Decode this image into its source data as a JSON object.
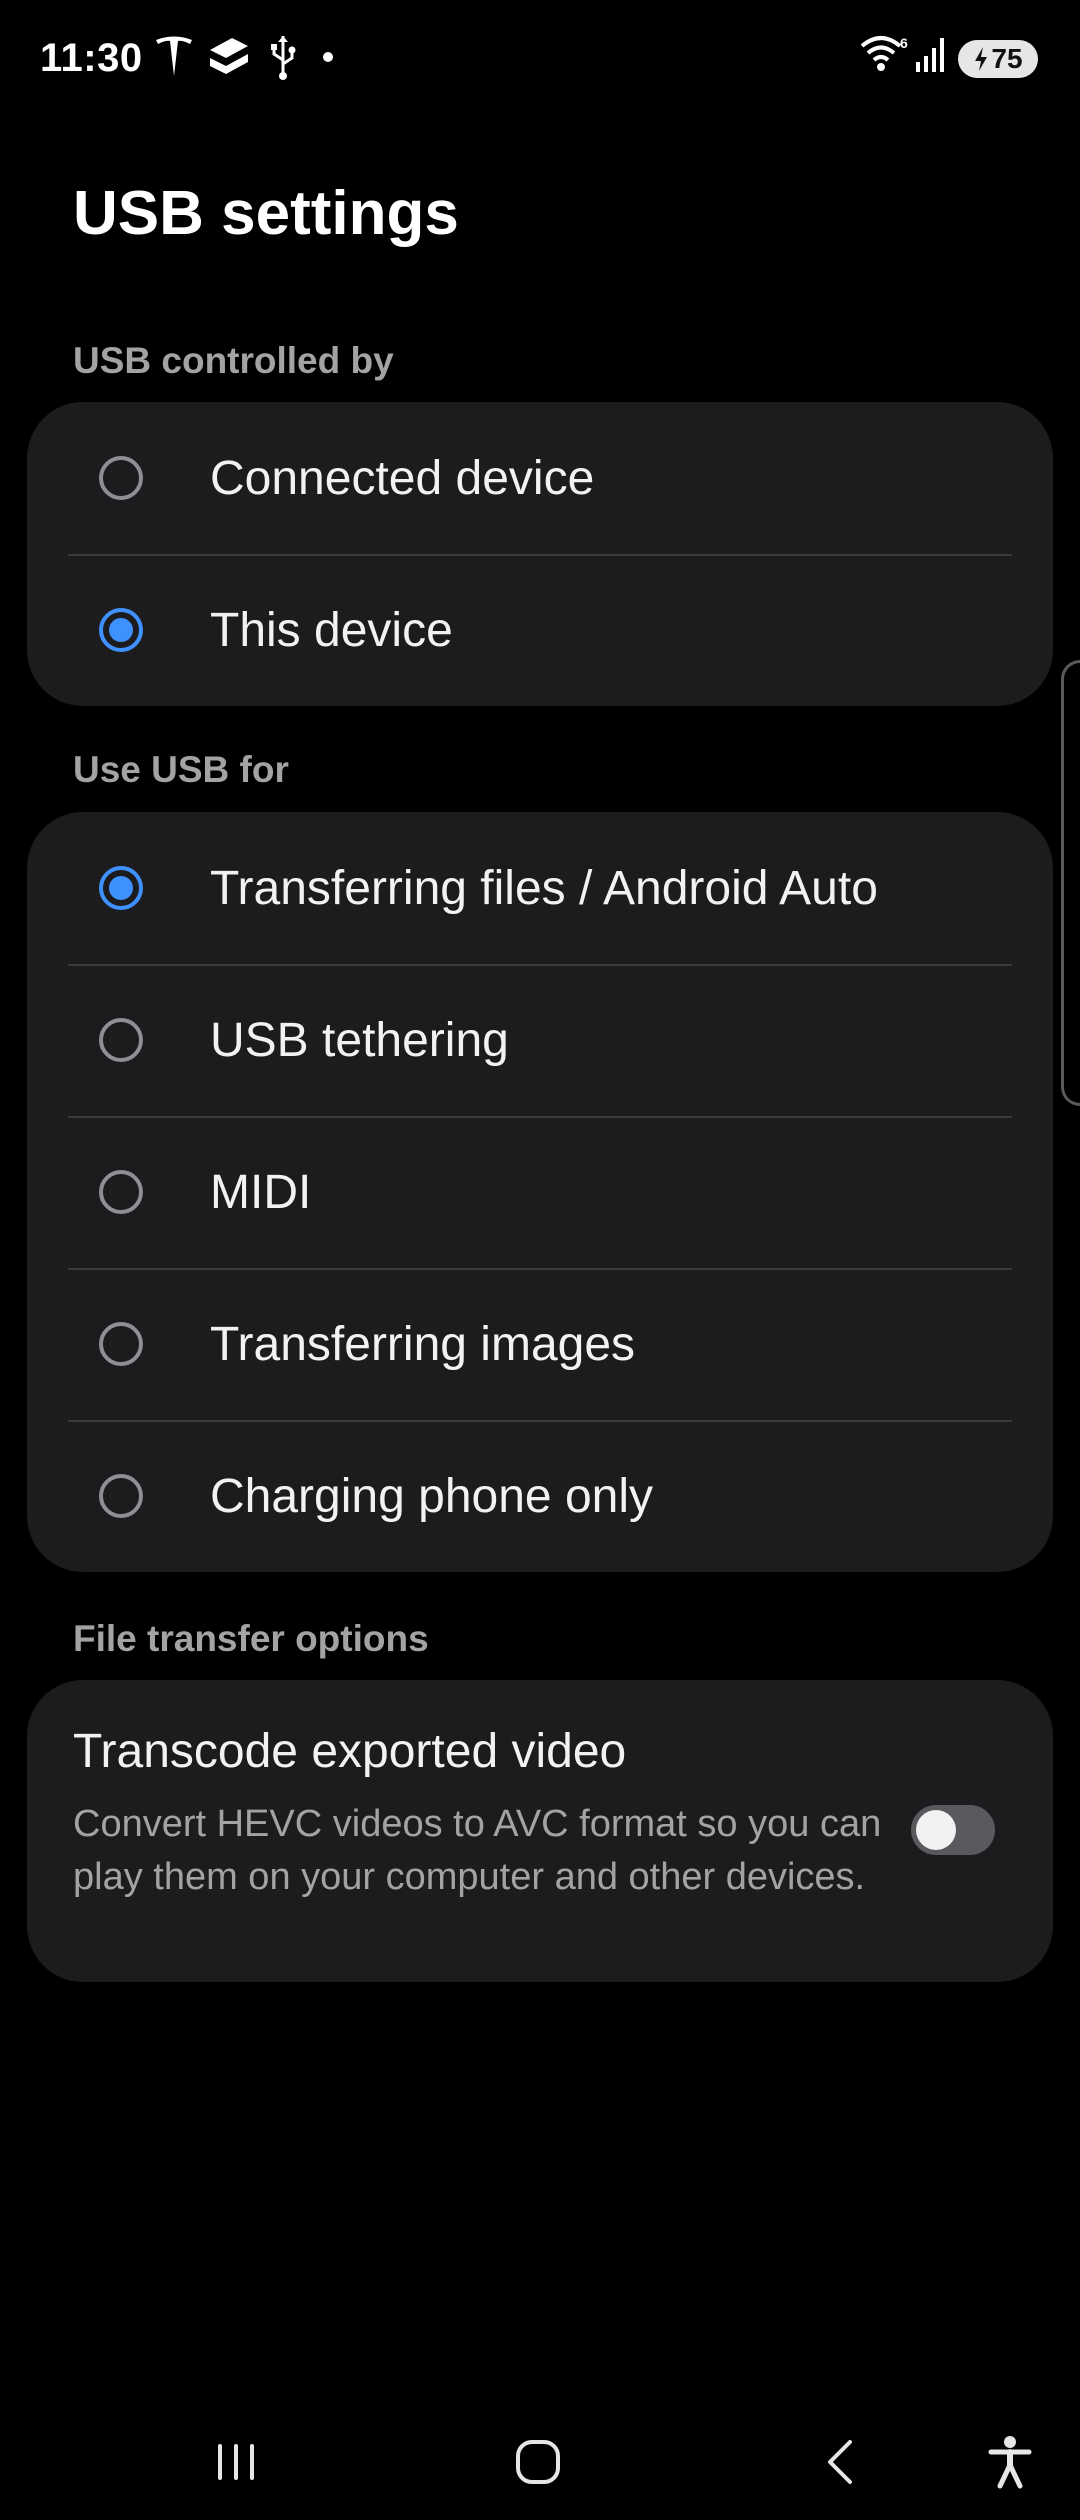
{
  "status_bar": {
    "time": "11:30",
    "battery_level": "75",
    "signal_badge": "6",
    "icons": [
      "tesla-icon",
      "sheets-icon",
      "usb-icon",
      "dot-icon",
      "wifi-icon",
      "signal-icon",
      "battery-charging-icon"
    ]
  },
  "page": {
    "title": "USB settings"
  },
  "usb_controlled_by": {
    "label": "USB controlled by",
    "options": [
      {
        "label": "Connected device",
        "checked": false
      },
      {
        "label": "This device",
        "checked": true
      }
    ]
  },
  "use_usb_for": {
    "label": "Use USB for",
    "options": [
      {
        "label": "Transferring files / Android Auto",
        "checked": true
      },
      {
        "label": "USB tethering",
        "checked": false
      },
      {
        "label": "MIDI",
        "checked": false
      },
      {
        "label": "Transferring images",
        "checked": false
      },
      {
        "label": "Charging phone only",
        "checked": false
      }
    ]
  },
  "file_transfer": {
    "label": "File transfer options",
    "title": "Transcode exported video",
    "description": "Convert HEVC videos to AVC format so you can play them on your computer and other devices.",
    "toggle_on": false
  },
  "nav_bar": {
    "icons": [
      "recents-icon",
      "home-icon",
      "back-icon",
      "accessibility-icon"
    ]
  },
  "colors": {
    "accent": "#3e91ff",
    "card": "#1c1c1e",
    "background": "#000000",
    "secondary_text": "#a3a3a3"
  }
}
